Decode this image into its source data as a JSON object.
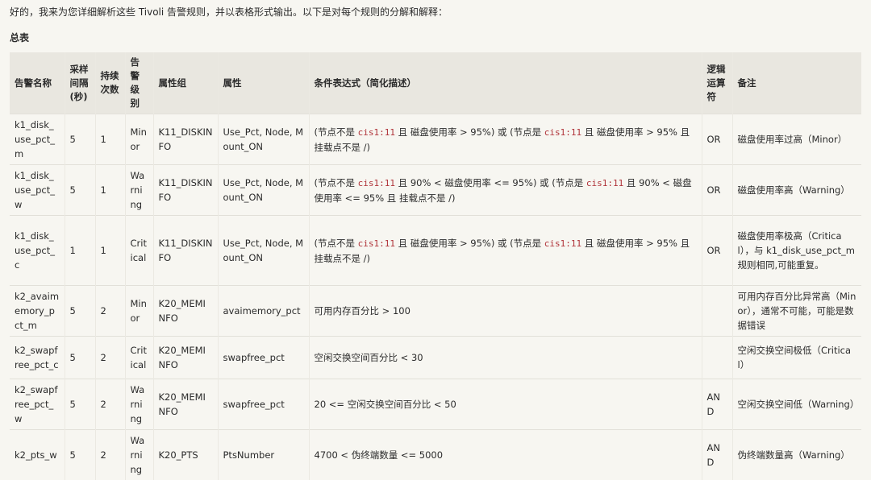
{
  "intro": "好的，我来为您详细解析这些 Tivoli 告警规则，并以表格形式输出。以下是对每个规则的分解和解释：",
  "heading": "总表",
  "headers": [
    "告警名称",
    "采样间隔(秒)",
    "持续次数",
    "告警级别",
    "属性组",
    "属性",
    "条件表达式（简化描述）",
    "逻辑运算符",
    "备注"
  ],
  "rows": [
    {
      "cells": [
        "k1_disk_use_pct_m",
        "5",
        "1",
        "Minor",
        "K11_DISKINFO",
        "Use_Pct, Node, Mount_ON"
      ],
      "cond": [
        "(节点不是 ",
        {
          "code": "cis1:11"
        },
        " 且 磁盘使用率 > 95%) 或 (节点是 ",
        {
          "code": "cis1:11"
        },
        " 且 磁盘使用率 > 95% 且 挂载点不是 /)"
      ],
      "logic": "OR",
      "note": "磁盘使用率过高（Minor）",
      "h": 46
    },
    {
      "cells": [
        "k1_disk_use_pct_w",
        "5",
        "1",
        "Warning",
        "K11_DISKINFO",
        "Use_Pct, Node, Mount_ON"
      ],
      "cond": [
        "(节点不是 ",
        {
          "code": "cis1:11"
        },
        " 且 90% < 磁盘使用率 <= 95%) 或 (节点是 ",
        {
          "code": "cis1:11"
        },
        " 且 90% < 磁盘使用率 <= 95% 且 挂载点不是 /)"
      ],
      "logic": "OR",
      "note": "磁盘使用率高（Warning）",
      "h": 49
    },
    {
      "cells": [
        "k1_disk_use_pct_c",
        "1",
        "1",
        "Critical",
        "K11_DISKINFO",
        "Use_Pct, Node, Mount_ON"
      ],
      "cond": [
        "(节点不是 ",
        {
          "code": "cis1:11"
        },
        " 且 磁盘使用率 > 95%) 或 (节点是 ",
        {
          "code": "cis1:11"
        },
        " 且 磁盘使用率 > 95% 且 挂载点不是 /)"
      ],
      "logic": "OR",
      "note": "磁盘使用率极高（Critical），与 k1_disk_use_pct_m 规则相同,可能重复。",
      "h": 87
    },
    {
      "cells": [
        "k2_avaimemory_pct_m",
        "5",
        "2",
        "Minor",
        "K20_MEMINFO",
        "avaimemory_pct"
      ],
      "cond": [
        "可用内存百分比 > 100"
      ],
      "logic": "",
      "note": "可用内存百分比异常高（Minor），通常不可能，可能是数据错误",
      "h": 61
    },
    {
      "cells": [
        "k2_swapfree_pct_c",
        "5",
        "2",
        "Critical",
        "K20_MEMINFO",
        "swapfree_pct"
      ],
      "cond": [
        "空闲交换空间百分比 < 30"
      ],
      "logic": "",
      "note": "空闲交换空间极低（Critical）",
      "h": 53
    },
    {
      "cells": [
        "k2_swapfree_pct_w",
        "5",
        "2",
        "Warning",
        "K20_MEMINFO",
        "swapfree_pct"
      ],
      "cond": [
        "20 <= 空闲交换空间百分比 < 50"
      ],
      "logic": "AND",
      "note": "空闲交换空间低（Warning）",
      "h": 60
    },
    {
      "cells": [
        "k2_pts_w",
        "5",
        "2",
        "Warning",
        "K20_PTS",
        "PtsNumber"
      ],
      "cond": [
        "4700 < 伪终端数量 <= 5000"
      ],
      "logic": "AND",
      "note": "伪终端数量高（Warning）",
      "h": 56
    }
  ]
}
